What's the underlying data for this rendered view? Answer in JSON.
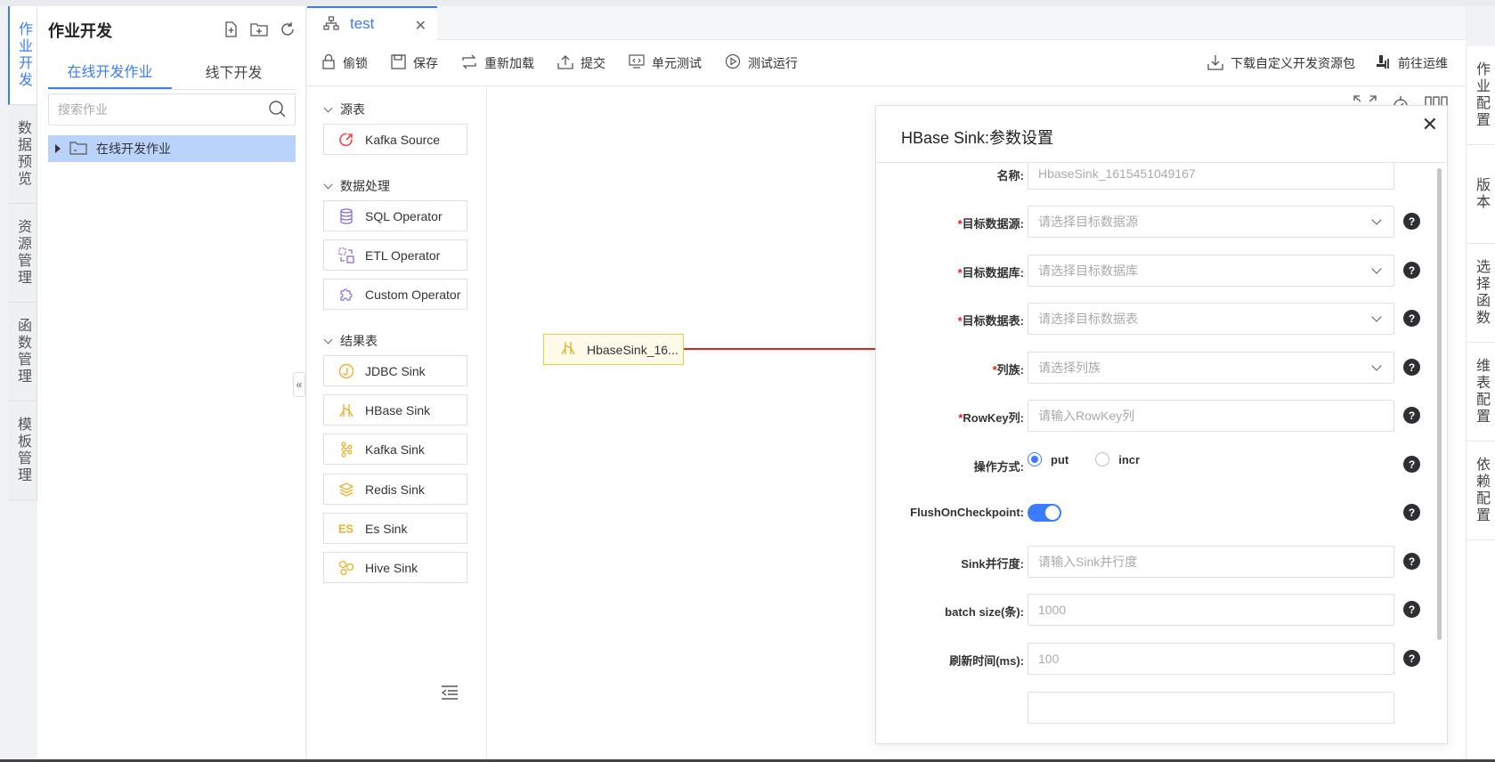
{
  "left_nav": {
    "items": [
      {
        "label": "作业开发",
        "active": true
      },
      {
        "label": "数据预览"
      },
      {
        "label": "资源管理"
      },
      {
        "label": "函数管理"
      },
      {
        "label": "模板管理"
      }
    ]
  },
  "job_panel": {
    "title": "作业开发",
    "tabs": [
      {
        "label": "在线开发作业",
        "active": true
      },
      {
        "label": "线下开发"
      }
    ],
    "search_placeholder": "搜索作业",
    "tree": [
      {
        "label": "在线开发作业"
      }
    ]
  },
  "tabs": [
    {
      "label": "test"
    }
  ],
  "toolbar": {
    "lock": "偷锁",
    "save": "保存",
    "reload": "重新加载",
    "submit": "提交",
    "unit_test": "单元测试",
    "test_run": "测试运行",
    "download": "下载自定义开发资源包",
    "goto_ops": "前往运维"
  },
  "palette": {
    "groups": [
      {
        "title": "源表",
        "items": [
          "Kafka Source"
        ]
      },
      {
        "title": "数据处理",
        "items": [
          "SQL Operator",
          "ETL Operator",
          "Custom Operator"
        ]
      },
      {
        "title": "结果表",
        "items": [
          "JDBC Sink",
          "HBase Sink",
          "Kafka Sink",
          "Redis Sink",
          "Es Sink",
          "Hive Sink"
        ]
      }
    ]
  },
  "canvas": {
    "node_label": "HbaseSink_16..."
  },
  "dialog": {
    "title": "HBase Sink:参数设置",
    "fields": {
      "name": {
        "label": "名称:",
        "value": "HbaseSink_1615451049167"
      },
      "target_source": {
        "label": "目标数据源:",
        "placeholder": "请选择目标数据源"
      },
      "target_db": {
        "label": "目标数据库:",
        "placeholder": "请选择目标数据库"
      },
      "target_table": {
        "label": "目标数据表:",
        "placeholder": "请选择目标数据表"
      },
      "column_family": {
        "label": "列族:",
        "placeholder": "请选择列族"
      },
      "rowkey": {
        "label": "RowKey列:",
        "placeholder": "请输入RowKey列"
      },
      "op_mode": {
        "label": "操作方式:",
        "options": [
          "put",
          "incr"
        ],
        "selected": "put"
      },
      "flush": {
        "label": "FlushOnCheckpoint:",
        "enabled": true
      },
      "parallelism": {
        "label": "Sink并行度:",
        "placeholder": "请输入Sink并行度"
      },
      "batch_size": {
        "label": "batch size(条):",
        "placeholder": "1000"
      },
      "flush_interval": {
        "label": "刷新时间(ms):",
        "placeholder": "100"
      }
    },
    "help_mark": "?"
  },
  "right_nav": {
    "items": [
      {
        "label": "作业配置"
      },
      {
        "label": "版本"
      },
      {
        "label": "选择函数"
      },
      {
        "label": "维表配置"
      },
      {
        "label": "依赖配置"
      }
    ]
  },
  "colors": {
    "accent": "#3a7bff",
    "node_border": "#f5c542",
    "arrow": "#e02020",
    "required": "#e02020"
  }
}
